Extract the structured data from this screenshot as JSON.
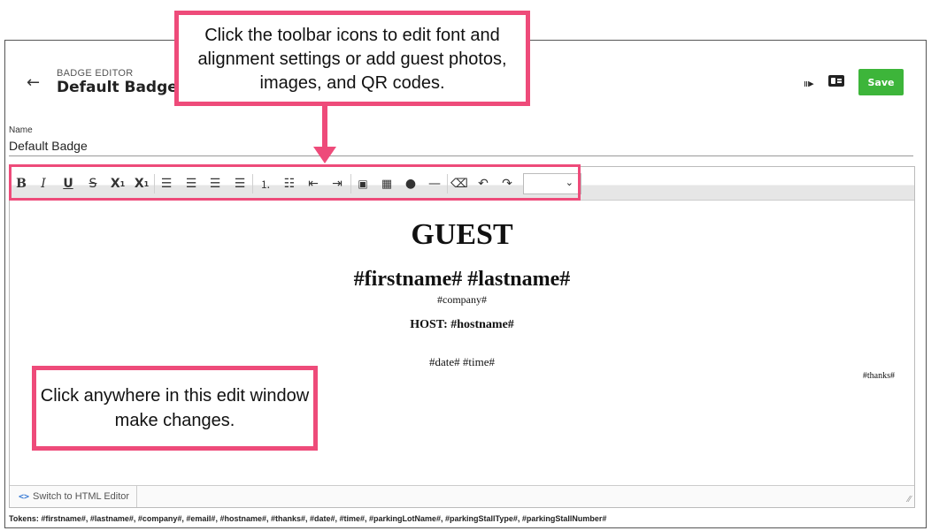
{
  "header": {
    "eyebrow": "BADGE EDITOR",
    "title": "Default Badge",
    "back_icon": "arrow-left-icon",
    "action_icons": [
      "print-icon",
      "id-card-icon"
    ],
    "save_label": "Save",
    "save_color": "#3db53a"
  },
  "form": {
    "name_label": "Name",
    "name_value": "Default Badge"
  },
  "toolbar": {
    "buttons": [
      "bold",
      "italic",
      "underline",
      "strikethrough",
      "subscript",
      "superscript",
      "align-left",
      "align-center",
      "align-right",
      "justify",
      "ordered-list",
      "unordered-list",
      "outdent",
      "indent",
      "image",
      "qr-code",
      "guest-photo",
      "horizontal-rule",
      "clear-formatting",
      "undo",
      "redo"
    ],
    "font_size_select": ""
  },
  "badge": {
    "title": "GUEST",
    "name_line": "#firstname# #lastname#",
    "company": "#company#",
    "host_line": "HOST: #hostname#",
    "datetime": "#date# #time#",
    "thanks": "#thanks#"
  },
  "editor_footer": {
    "switch_label": "Switch to HTML Editor"
  },
  "tokens_line": "Tokens: #firstname#, #lastname#, #company#, #email#, #hostname#, #thanks#, #date#, #time#, #parkingLotName#, #parkingStallType#, #parkingStallNumber#",
  "annotations": {
    "toolbar_callout": "Click the toolbar icons to edit font and alignment settings or add guest photos, images, and QR codes.",
    "edit_callout": "Click anywhere in this edit window make changes.",
    "accent_color": "#ee4b7a"
  }
}
